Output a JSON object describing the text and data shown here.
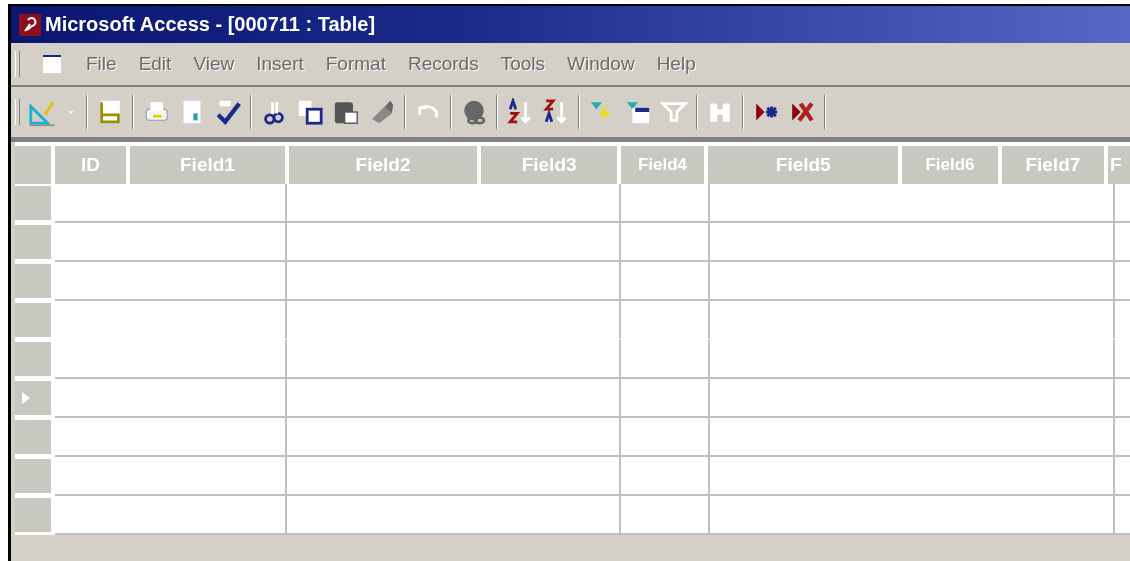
{
  "window": {
    "title": "Microsoft Access - [000711 : Table]"
  },
  "menu": [
    "File",
    "Edit",
    "View",
    "Insert",
    "Format",
    "Records",
    "Tools",
    "Window",
    "Help"
  ],
  "table": {
    "columns": [
      "ID",
      "Field1",
      "Field2",
      "Field3",
      "Field4",
      "Field5",
      "Field6",
      "Field7",
      "F"
    ],
    "rows": [
      {
        "current": false
      },
      {
        "current": false
      },
      {
        "current": false
      },
      {
        "current": false
      },
      {
        "current": false
      },
      {
        "current": true
      },
      {
        "current": false
      },
      {
        "current": false
      },
      {
        "current": false
      }
    ]
  }
}
